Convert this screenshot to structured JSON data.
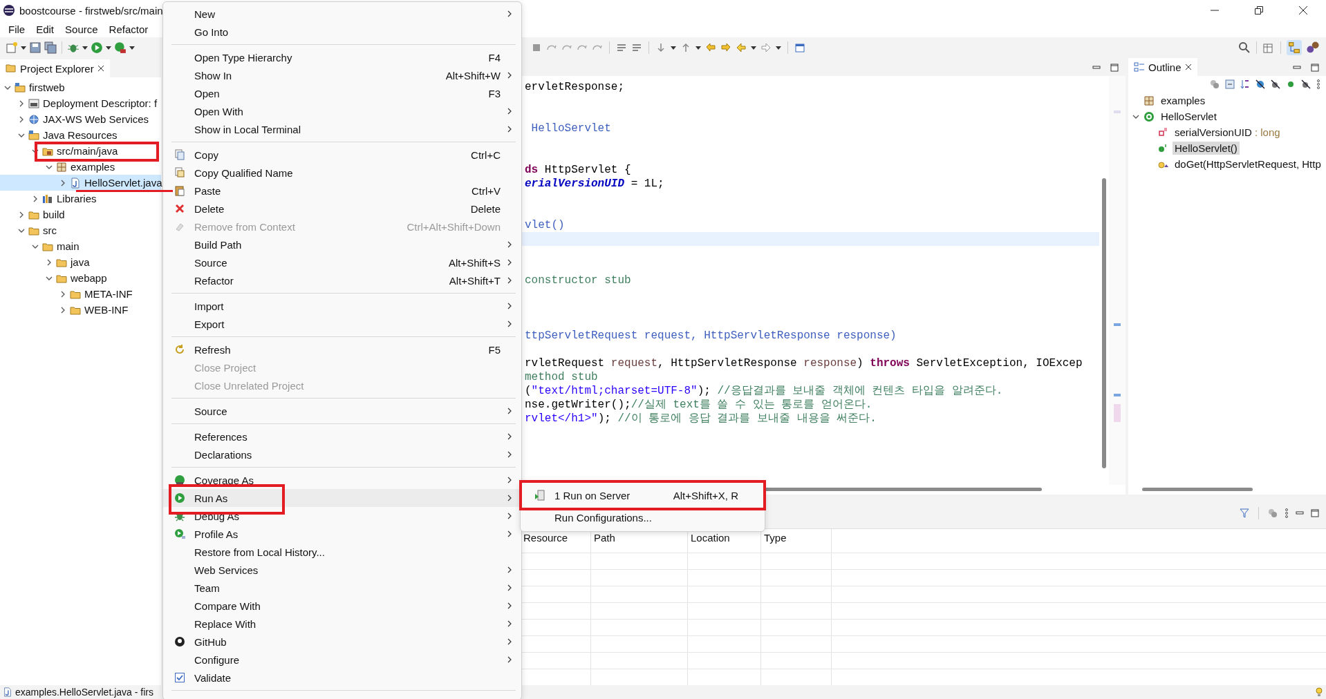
{
  "window": {
    "title": "boostcourse - firstweb/src/main"
  },
  "menu_bar": [
    "File",
    "Edit",
    "Source",
    "Refactor"
  ],
  "project_explorer": {
    "title": "Project Explorer",
    "items": [
      {
        "label": "firstweb",
        "expanded": true,
        "selected": false,
        "highlighted": false,
        "underlined": false,
        "children": [
          {
            "label": "Deployment Descriptor: f",
            "expanded": false,
            "selected": false,
            "highlighted": false,
            "underlined": false
          },
          {
            "label": "JAX-WS Web Services",
            "expanded": false,
            "selected": false,
            "highlighted": false,
            "underlined": false
          },
          {
            "label": "Java Resources",
            "expanded": true,
            "selected": false,
            "highlighted": false,
            "underlined": false,
            "children": [
              {
                "label": "src/main/java",
                "expanded": true,
                "selected": false,
                "highlighted": true,
                "underlined": false,
                "children": [
                  {
                    "label": "examples",
                    "expanded": true,
                    "selected": false,
                    "highlighted": false,
                    "underlined": false,
                    "children": [
                      {
                        "label": "HelloServlet.java",
                        "expanded": false,
                        "selected": true,
                        "highlighted": false,
                        "underlined": true
                      }
                    ]
                  }
                ]
              },
              {
                "label": "Libraries",
                "expanded": false,
                "selected": false,
                "highlighted": false,
                "underlined": false
              }
            ]
          },
          {
            "label": "build",
            "expanded": false,
            "selected": false,
            "highlighted": false,
            "underlined": false
          },
          {
            "label": "src",
            "expanded": true,
            "selected": false,
            "highlighted": false,
            "underlined": false,
            "children": [
              {
                "label": "main",
                "expanded": true,
                "selected": false,
                "highlighted": false,
                "underlined": false,
                "children": [
                  {
                    "label": "java",
                    "expanded": false,
                    "selected": false,
                    "highlighted": false,
                    "underlined": false
                  },
                  {
                    "label": "webapp",
                    "expanded": true,
                    "selected": false,
                    "highlighted": false,
                    "underlined": false,
                    "children": [
                      {
                        "label": "META-INF",
                        "expanded": false,
                        "selected": false,
                        "highlighted": false,
                        "underlined": false
                      },
                      {
                        "label": "WEB-INF",
                        "expanded": false,
                        "selected": false,
                        "highlighted": false,
                        "underlined": false
                      }
                    ]
                  }
                ]
              }
            ]
          }
        ]
      }
    ]
  },
  "editor": {
    "lines": [
      {
        "kind": "code",
        "segments": [
          {
            "text": "ervletResponse;",
            "kind": "plain"
          }
        ]
      },
      {
        "kind": "blank",
        "current": false
      },
      {
        "kind": "blank",
        "current": false
      },
      {
        "kind": "code",
        "segments": [
          {
            "text": " HelloServlet",
            "kind": "doc"
          }
        ]
      },
      {
        "kind": "blank",
        "current": false
      },
      {
        "kind": "blank",
        "current": false
      },
      {
        "kind": "code",
        "segments": [
          {
            "text": "ds",
            "kind": "keyword"
          },
          {
            "text": " HttpServlet {",
            "kind": "plain"
          }
        ]
      },
      {
        "kind": "code",
        "segments": [
          {
            "text": "erialVersionUID",
            "kind": "field"
          },
          {
            "text": " = 1L;",
            "kind": "plain"
          }
        ]
      },
      {
        "kind": "blank",
        "current": false
      },
      {
        "kind": "blank",
        "current": false
      },
      {
        "kind": "code",
        "segments": [
          {
            "text": "vlet()",
            "kind": "doc"
          }
        ]
      },
      {
        "kind": "blank",
        "current": true
      },
      {
        "kind": "blank",
        "current": false
      },
      {
        "kind": "blank",
        "current": false
      },
      {
        "kind": "code",
        "segments": [
          {
            "text": "constructor stub",
            "kind": "comment"
          }
        ]
      },
      {
        "kind": "blank",
        "current": false
      },
      {
        "kind": "blank",
        "current": false
      },
      {
        "kind": "blank",
        "current": false
      },
      {
        "kind": "code",
        "segments": [
          {
            "text": "ttpServletRequest request, HttpServletResponse response)",
            "kind": "doc"
          }
        ]
      },
      {
        "kind": "blank",
        "current": false
      },
      {
        "kind": "code",
        "segments": [
          {
            "text": "rvletRequest ",
            "kind": "plain"
          },
          {
            "text": "request",
            "kind": "param"
          },
          {
            "text": ", HttpServletResponse ",
            "kind": "plain"
          },
          {
            "text": "response",
            "kind": "param"
          },
          {
            "text": ") ",
            "kind": "plain"
          },
          {
            "text": "throws",
            "kind": "keyword"
          },
          {
            "text": " ServletException, IOExcep",
            "kind": "plain"
          }
        ]
      },
      {
        "kind": "code",
        "segments": [
          {
            "text": "method stub",
            "kind": "comment"
          }
        ]
      },
      {
        "kind": "code",
        "segments": [
          {
            "text": "(",
            "kind": "plain"
          },
          {
            "text": "\"text/html;charset=UTF-8\"",
            "kind": "string"
          },
          {
            "text": "); ",
            "kind": "plain"
          },
          {
            "text": "//응답결과를 보내줄 객체에 컨텐츠 타입을 알려준다.",
            "kind": "comment"
          }
        ]
      },
      {
        "kind": "code",
        "segments": [
          {
            "text": "nse.getWriter();",
            "kind": "plain"
          },
          {
            "text": "//실제 text를 쓸 수 있는 통로를 얻어온다.",
            "kind": "comment"
          }
        ]
      },
      {
        "kind": "code",
        "segments": [
          {
            "text": "rvlet</h1>\"",
            "kind": "string"
          },
          {
            "text": "); ",
            "kind": "plain"
          },
          {
            "text": "//이 통로에 응답 결과를 보내줄 내용을 써준다.",
            "kind": "comment"
          }
        ]
      }
    ]
  },
  "outline": {
    "title": "Outline",
    "items": [
      {
        "label": "examples",
        "selected": false
      },
      {
        "label": "HelloServlet",
        "expanded": true,
        "selected": false,
        "children": [
          {
            "label": "serialVersionUID",
            "type": " : long",
            "selected": false
          },
          {
            "label": "HelloServlet()",
            "selected": true
          },
          {
            "label": "doGet(HttpServletRequest, Http",
            "selected": false
          }
        ]
      }
    ]
  },
  "context_menu": {
    "items": [
      {
        "kind": "item",
        "label": "New",
        "submenu": true,
        "disabled": false,
        "selected": false,
        "highlighted": false
      },
      {
        "kind": "item",
        "label": "Go Into",
        "submenu": false,
        "disabled": false,
        "selected": false,
        "highlighted": false
      },
      {
        "kind": "separator"
      },
      {
        "kind": "item",
        "label": "Open Type Hierarchy",
        "shortcut": "F4",
        "submenu": false,
        "disabled": false,
        "selected": false,
        "highlighted": false
      },
      {
        "kind": "item",
        "label": "Show In",
        "shortcut": "Alt+Shift+W",
        "submenu": true,
        "disabled": false,
        "selected": false,
        "highlighted": false
      },
      {
        "kind": "item",
        "label": "Open",
        "shortcut": "F3",
        "submenu": false,
        "disabled": false,
        "selected": false,
        "highlighted": false
      },
      {
        "kind": "item",
        "label": "Open With",
        "submenu": true,
        "disabled": false,
        "selected": false,
        "highlighted": false
      },
      {
        "kind": "item",
        "label": "Show in Local Terminal",
        "submenu": true,
        "disabled": false,
        "selected": false,
        "highlighted": false
      },
      {
        "kind": "separator"
      },
      {
        "kind": "item",
        "label": "Copy",
        "shortcut": "Ctrl+C",
        "submenu": false,
        "disabled": false,
        "selected": false,
        "highlighted": false
      },
      {
        "kind": "item",
        "label": "Copy Qualified Name",
        "submenu": false,
        "disabled": false,
        "selected": false,
        "highlighted": false
      },
      {
        "kind": "item",
        "label": "Paste",
        "shortcut": "Ctrl+V",
        "submenu": false,
        "disabled": false,
        "selected": false,
        "highlighted": false
      },
      {
        "kind": "item",
        "label": "Delete",
        "shortcut": "Delete",
        "submenu": false,
        "disabled": false,
        "selected": false,
        "highlighted": false
      },
      {
        "kind": "item",
        "label": "Remove from Context",
        "shortcut": "Ctrl+Alt+Shift+Down",
        "submenu": false,
        "disabled": true,
        "selected": false,
        "highlighted": false
      },
      {
        "kind": "item",
        "label": "Build Path",
        "submenu": true,
        "disabled": false,
        "selected": false,
        "highlighted": false
      },
      {
        "kind": "item",
        "label": "Source",
        "shortcut": "Alt+Shift+S",
        "submenu": true,
        "disabled": false,
        "selected": false,
        "highlighted": false
      },
      {
        "kind": "item",
        "label": "Refactor",
        "shortcut": "Alt+Shift+T",
        "submenu": true,
        "disabled": false,
        "selected": false,
        "highlighted": false
      },
      {
        "kind": "separator"
      },
      {
        "kind": "item",
        "label": "Import",
        "submenu": true,
        "disabled": false,
        "selected": false,
        "highlighted": false
      },
      {
        "kind": "item",
        "label": "Export",
        "submenu": true,
        "disabled": false,
        "selected": false,
        "highlighted": false
      },
      {
        "kind": "separator"
      },
      {
        "kind": "item",
        "label": "Refresh",
        "shortcut": "F5",
        "submenu": false,
        "disabled": false,
        "selected": false,
        "highlighted": false
      },
      {
        "kind": "item",
        "label": "Close Project",
        "submenu": false,
        "disabled": true,
        "selected": false,
        "highlighted": false
      },
      {
        "kind": "item",
        "label": "Close Unrelated Project",
        "submenu": false,
        "disabled": true,
        "selected": false,
        "highlighted": false
      },
      {
        "kind": "separator"
      },
      {
        "kind": "item",
        "label": "Source",
        "submenu": true,
        "disabled": false,
        "selected": false,
        "highlighted": false
      },
      {
        "kind": "separator"
      },
      {
        "kind": "item",
        "label": "References",
        "submenu": true,
        "disabled": false,
        "selected": false,
        "highlighted": false
      },
      {
        "kind": "item",
        "label": "Declarations",
        "submenu": true,
        "disabled": false,
        "selected": false,
        "highlighted": false
      },
      {
        "kind": "separator"
      },
      {
        "kind": "item",
        "label": "Coverage As",
        "submenu": true,
        "disabled": false,
        "selected": false,
        "highlighted": false
      },
      {
        "kind": "item",
        "label": "Run As",
        "submenu": true,
        "disabled": false,
        "selected": true,
        "highlighted": true
      },
      {
        "kind": "item",
        "label": "Debug As",
        "submenu": true,
        "disabled": false,
        "selected": false,
        "highlighted": false
      },
      {
        "kind": "item",
        "label": "Profile As",
        "submenu": true,
        "disabled": false,
        "selected": false,
        "highlighted": false
      },
      {
        "kind": "item",
        "label": "Restore from Local History...",
        "submenu": false,
        "disabled": false,
        "selected": false,
        "highlighted": false
      },
      {
        "kind": "item",
        "label": "Web Services",
        "submenu": true,
        "disabled": false,
        "selected": false,
        "highlighted": false
      },
      {
        "kind": "item",
        "label": "Team",
        "submenu": true,
        "disabled": false,
        "selected": false,
        "highlighted": false
      },
      {
        "kind": "item",
        "label": "Compare With",
        "submenu": true,
        "disabled": false,
        "selected": false,
        "highlighted": false
      },
      {
        "kind": "item",
        "label": "Replace With",
        "submenu": true,
        "disabled": false,
        "selected": false,
        "highlighted": false
      },
      {
        "kind": "item",
        "label": "GitHub",
        "submenu": true,
        "disabled": false,
        "selected": false,
        "highlighted": false
      },
      {
        "kind": "item",
        "label": "Configure",
        "submenu": true,
        "disabled": false,
        "selected": false,
        "highlighted": false
      },
      {
        "kind": "item",
        "label": "Validate",
        "submenu": false,
        "disabled": false,
        "selected": false,
        "highlighted": false
      },
      {
        "kind": "separator"
      }
    ]
  },
  "submenu": {
    "items": [
      {
        "label": "1 Run on Server",
        "shortcut": "Alt+Shift+X, R",
        "highlighted": true
      },
      {
        "label": "Run Configurations...",
        "highlighted": false
      }
    ]
  },
  "problems_table": {
    "columns": [
      "Resource",
      "Path",
      "Location",
      "Type"
    ]
  },
  "status_bar": {
    "text": "examples.HelloServlet.java - firs"
  }
}
